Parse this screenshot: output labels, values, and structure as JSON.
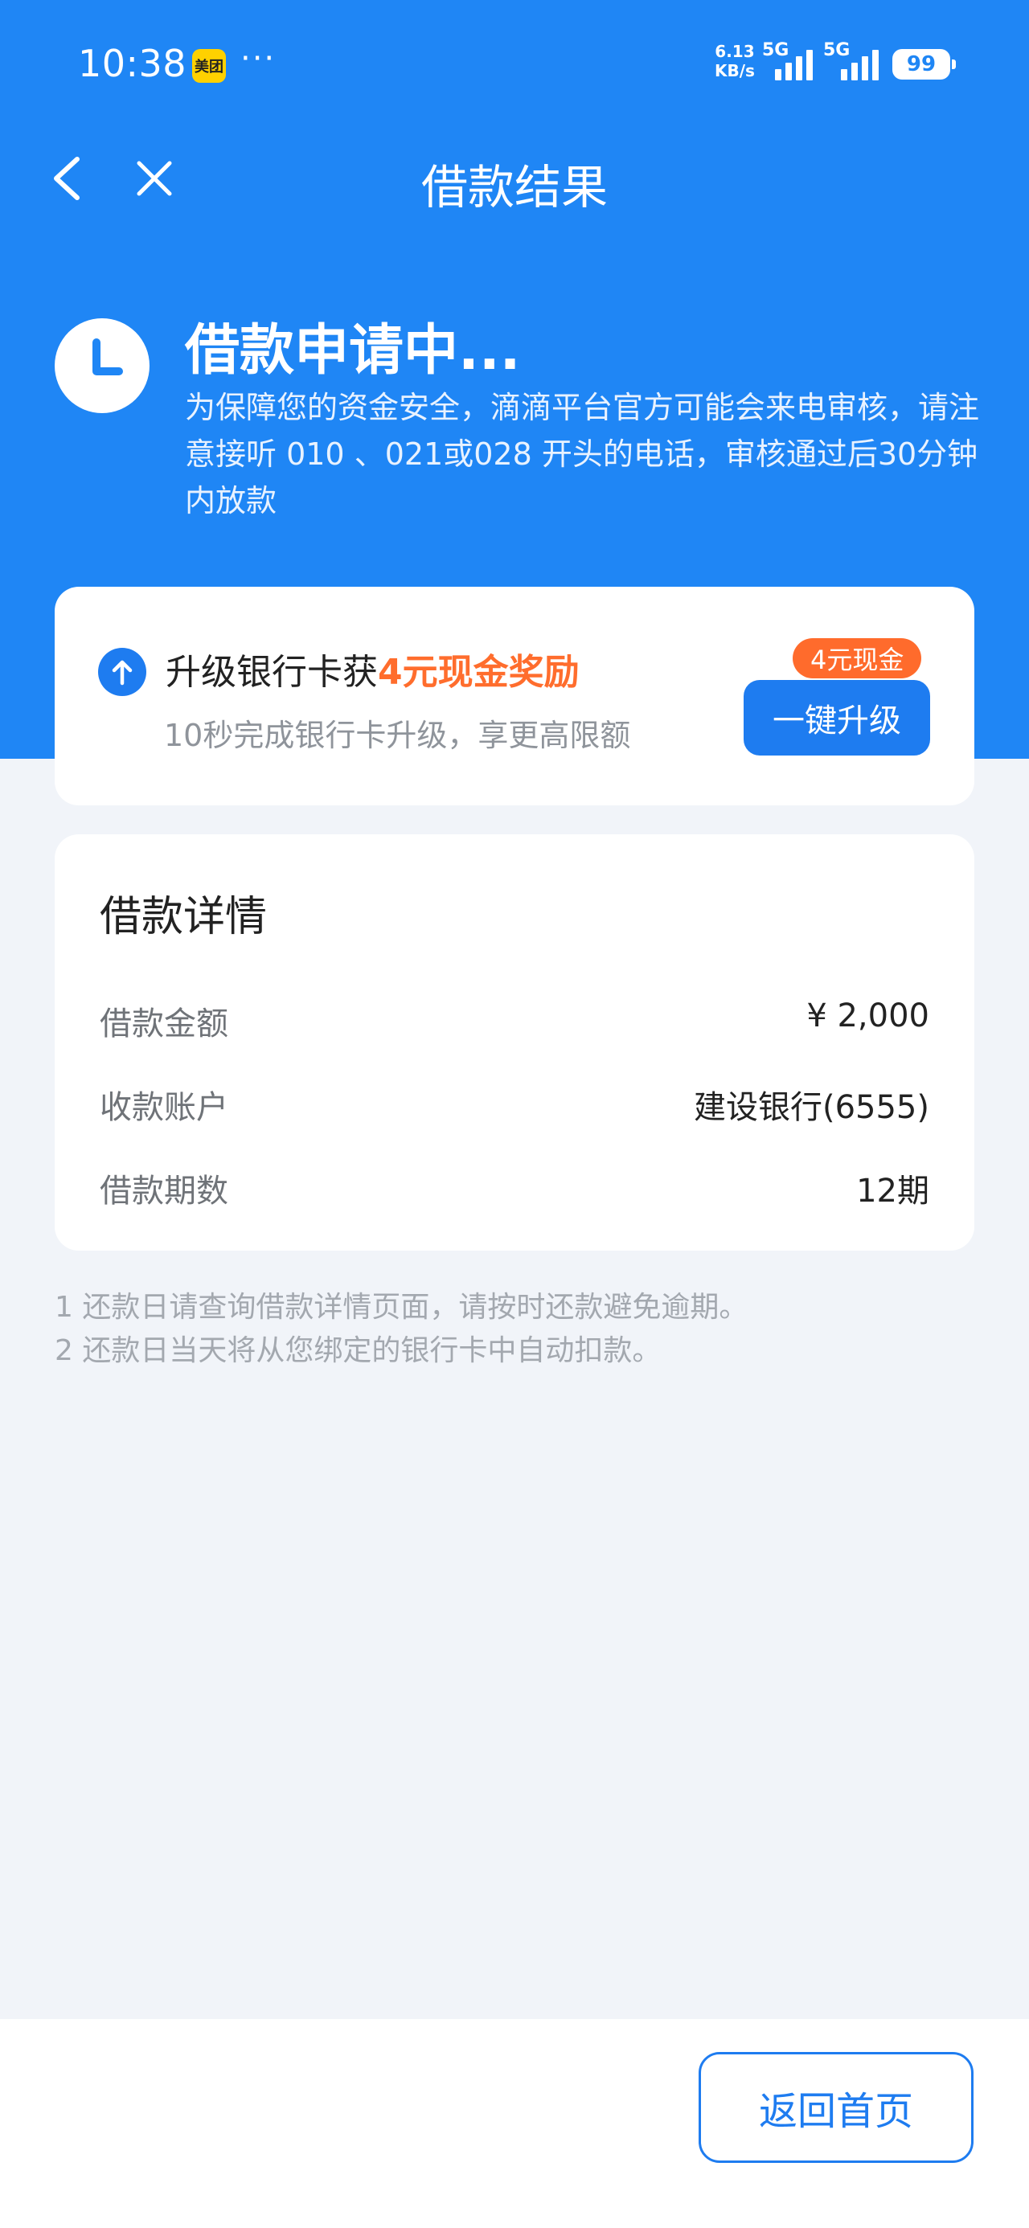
{
  "status_bar": {
    "time": "10:38",
    "app_badge": "美团",
    "more": "···",
    "speed_value": "6.13",
    "speed_unit": "KB/s",
    "net1": "5G",
    "net2": "5G",
    "battery": "99"
  },
  "nav": {
    "title": "借款结果"
  },
  "status": {
    "title": "借款申请中...",
    "description": "为保障您的资金安全，滴滴平台官方可能会来电审核，请注意接听 010 、021或028 开头的电话，审核通过后30分钟内放款"
  },
  "upgrade": {
    "title_prefix": "升级银行卡获",
    "title_highlight": "4元现金奖励",
    "subtitle": "10秒完成银行卡升级，享更高限额",
    "badge": "4元现金",
    "button": "一键升级"
  },
  "details": {
    "title": "借款详情",
    "rows": [
      {
        "label": "借款金额",
        "value": "¥  2,000"
      },
      {
        "label": "收款账户",
        "value": "建设银行(6555)"
      },
      {
        "label": "借款期数",
        "value": "12期"
      }
    ]
  },
  "notes": [
    "1 还款日请查询借款详情页面，请按时还款避免逾期。",
    "2 还款日当天将从您绑定的银行卡中自动扣款。"
  ],
  "footer": {
    "home_button": "返回首页"
  },
  "colors": {
    "header_blue": "#1f86f5",
    "button_blue": "#1e7cf0",
    "accent_orange": "#ff6d2d",
    "page_bg": "#f1f4f9"
  },
  "icons": {
    "back": "chevron-left-icon",
    "close": "close-icon",
    "status": "clock-icon",
    "upgrade": "arrow-up-circle-icon"
  }
}
